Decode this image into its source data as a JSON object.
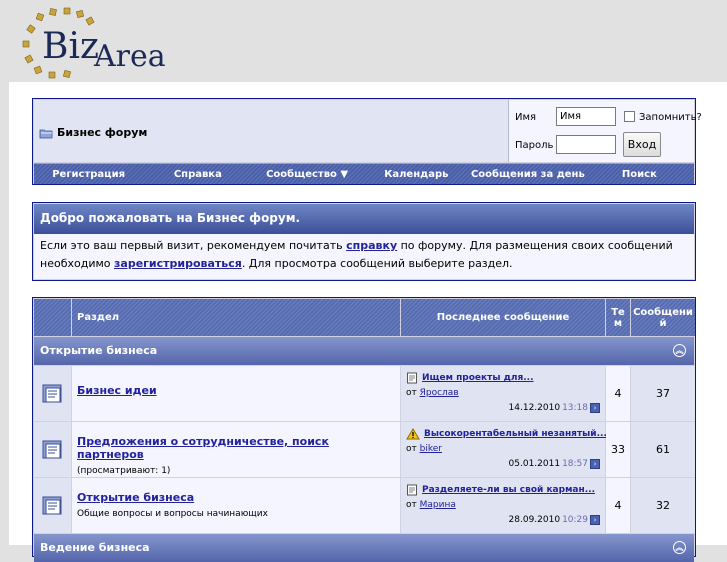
{
  "logo": {
    "part1": "Biz",
    "part2": "Area"
  },
  "navbar": {
    "breadcrumb": "Бизнес форум",
    "login": {
      "username_label": "Имя",
      "username_value": "Имя",
      "remember_label": "Запомнить?",
      "password_label": "Пароль",
      "login_button": "Вход"
    },
    "menu": [
      "Регистрация",
      "Справка",
      "Сообщество ▼",
      "Календарь",
      "Сообщения за день",
      "Поиск"
    ]
  },
  "welcome": {
    "title": "Добро пожаловать на Бизнес форум.",
    "text1": "Если это ваш первый визит, рекомендуем почитать ",
    "link1": "справку",
    "text2": " по форуму. Для размещения своих сообщений необходимо ",
    "link2": "зарегистрироваться",
    "text3": ". Для просмотра сообщений выберите раздел."
  },
  "forum": {
    "headers": {
      "section": "Раздел",
      "last_post": "Последнее сообщение",
      "threads": "Те м",
      "posts": "Сообщени й"
    },
    "category": "Открытие бизнеса",
    "rows": [
      {
        "title": "Бизнес идеи",
        "desc": "",
        "lp_title": "Ищем проекты для...",
        "lp_icon": "document-icon",
        "by": "от",
        "author": "Ярослав",
        "date": "14.12.2010",
        "time": "13:18",
        "threads": "4",
        "posts": "37"
      },
      {
        "title": "Предложения о сотрудничестве, поиск партнеров",
        "desc": "(просматривают: 1)",
        "lp_title": "Высокорентабельный незанятый...",
        "lp_icon": "warning-icon",
        "by": "от",
        "author": "biker",
        "date": "05.01.2011",
        "time": "18:57",
        "threads": "33",
        "posts": "61"
      },
      {
        "title": "Открытие бизнеса",
        "desc": "Общие вопросы и вопросы начинающих",
        "lp_title": "Разделяете-ли вы свой карман...",
        "lp_icon": "document-icon",
        "by": "от",
        "author": "Марина",
        "date": "28.09.2010",
        "time": "10:29",
        "threads": "4",
        "posts": "32"
      }
    ],
    "next_category": "Ведение бизнеса"
  }
}
